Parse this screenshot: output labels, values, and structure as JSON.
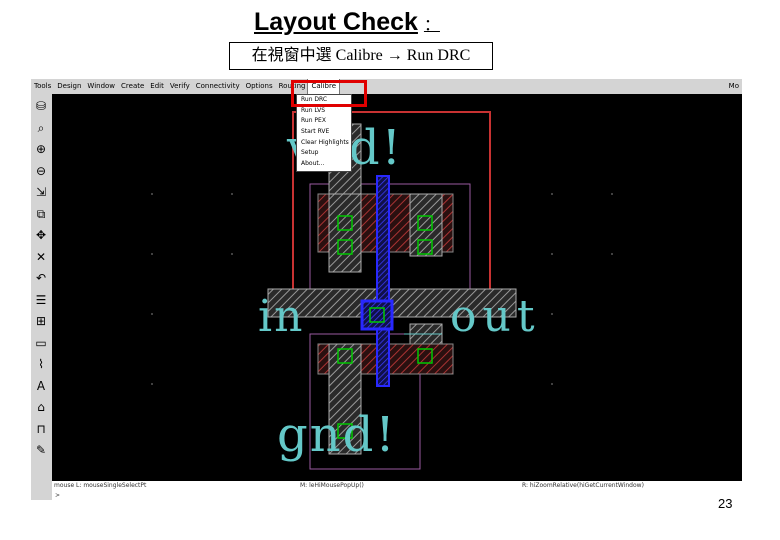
{
  "slide": {
    "title": "Layout Check",
    "title_colon": "：",
    "caption": "在視窗中選 Calibre  Run DRC",
    "caption_arrow": "→",
    "page_number": "23"
  },
  "menubar": {
    "items": [
      "Tools",
      "Design",
      "Window",
      "Create",
      "Edit",
      "Verify",
      "Connectivity",
      "Options",
      "Routing"
    ],
    "active_item": "Calibre",
    "tail": "Mo"
  },
  "calibre_menu": {
    "items": [
      "Run DRC",
      "Run LVS",
      "Run PEX",
      "Start RVE",
      "Clear Highlights",
      "Setup",
      "About..."
    ]
  },
  "toolbar": {
    "icons": [
      "save-icon",
      "find-icon",
      "zoom-in-icon",
      "zoom-out-icon",
      "stretch-icon",
      "copy-icon",
      "move-icon",
      "delete-icon",
      "undo-icon",
      "property-icon",
      "ruler-icon",
      "rectangle-icon",
      "path-icon",
      "label-icon",
      "instance-icon",
      "pin-icon",
      "edit-icon"
    ]
  },
  "layout": {
    "labels": {
      "vdd": "vdd!",
      "in": "in",
      "out": "out",
      "gnd": "gnd!"
    }
  },
  "status_bar": {
    "left": "mouse L: mouseSingleSelectPt",
    "middle": "M: leHiMousePopUp()",
    "right": "R: hiZoomRelative(hiGetCurrentWindow)"
  },
  "command_line": {
    "prompt": ">"
  },
  "colors": {
    "canvas_bg": "#000000",
    "menu_bg": "#d4d4d4",
    "highlight_red": "#e00000",
    "nwell_red": "#c83232",
    "poly_blue": "#2828ff",
    "active_green": "#00c800",
    "text_cyan": "#64c8c8",
    "select_purple": "#9a5aa0",
    "metal_stipple": "#8a8a8a"
  }
}
